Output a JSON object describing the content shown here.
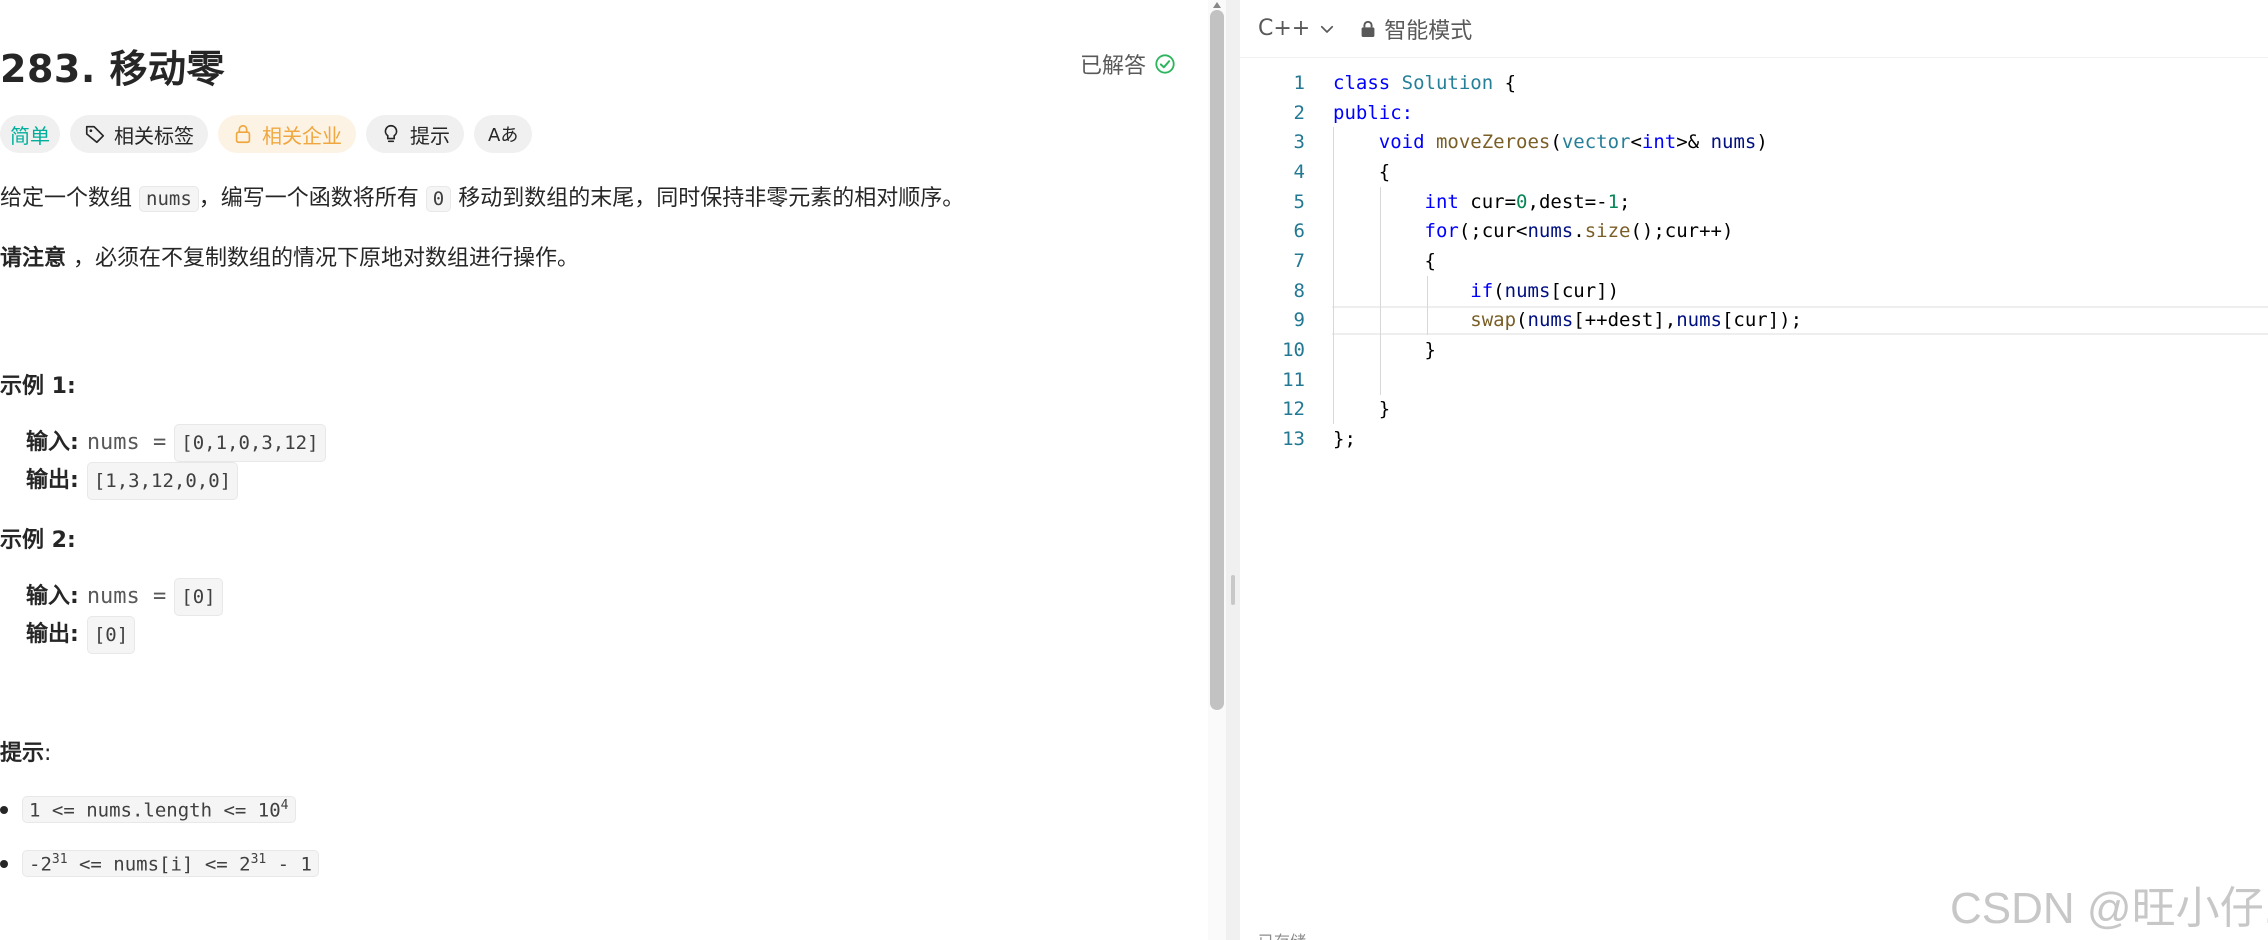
{
  "problem": {
    "title": "283. 移动零",
    "status": "已解答",
    "tags": {
      "difficulty": "简单",
      "related_tags": "相关标签",
      "related_companies": "相关企业",
      "hints": "提示",
      "translate": "Aあ"
    },
    "description": {
      "p1_before": "给定一个数组",
      "p1_code1": "nums",
      "p1_mid": "，编写一个函数将所有",
      "p1_code2": "0",
      "p1_after": "移动到数组的末尾，同时保持非零元素的相对顺序。",
      "p2_bold": "请注意",
      "p2_rest": "，必须在不复制数组的情况下原地对数组进行操作。"
    },
    "examples": [
      {
        "heading": "示例 1:",
        "input_label": "输入:",
        "input_var": "nums =",
        "input_value": "[0,1,0,3,12]",
        "output_label": "输出:",
        "output_value": "[1,3,12,0,0]"
      },
      {
        "heading": "示例 2:",
        "input_label": "输入:",
        "input_var": "nums =",
        "input_value": "[0]",
        "output_label": "输出:",
        "output_value": "[0]"
      }
    ],
    "constraints_heading": "提示",
    "constraints_colon": ":",
    "constraints": [
      {
        "pre": "1 <= nums.length <= 10",
        "sup": "4",
        "post": ""
      },
      {
        "pre": "-2",
        "sup": "31",
        "mid": " <= nums[i] <= 2",
        "sup2": "31",
        "post": " - 1"
      }
    ]
  },
  "editor": {
    "language": "C++",
    "mode": "智能模式",
    "line_numbers": [
      "1",
      "2",
      "3",
      "4",
      "5",
      "6",
      "7",
      "8",
      "9",
      "10",
      "11",
      "12",
      "13"
    ],
    "status_text": "已存储"
  },
  "watermark": "CSDN @旺小仔.",
  "colors": {
    "easy": "#00af9b",
    "company": "#f0a73f",
    "solved_check": "#2db55d",
    "keyword": "#0000ff",
    "type": "#267f99",
    "function": "#795e26",
    "number": "#098658",
    "variable": "#001080"
  }
}
